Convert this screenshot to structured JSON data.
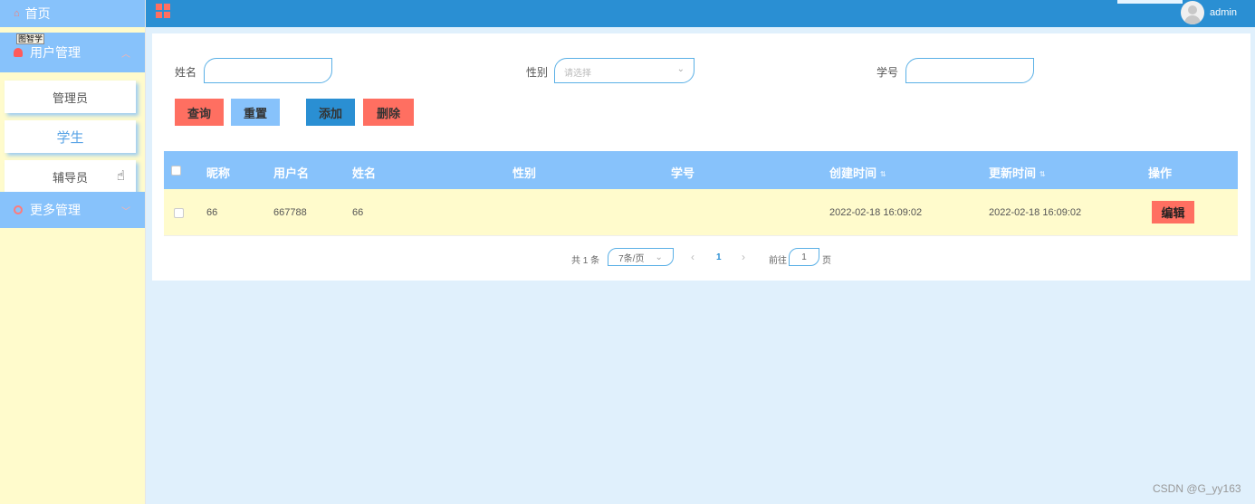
{
  "sidebar": {
    "home": "首页",
    "user_mgmt": "用户管理",
    "user_tag": "图智学",
    "items": [
      {
        "label": "管理员"
      },
      {
        "label": "学生"
      },
      {
        "label": "辅导员"
      }
    ],
    "more_mgmt": "更多管理"
  },
  "header": {
    "user": "admin"
  },
  "filters": {
    "name_label": "姓名",
    "name_value": "",
    "gender_label": "性别",
    "gender_placeholder": "请选择",
    "student_no_label": "学号",
    "student_no_value": ""
  },
  "actions": {
    "search": "查询",
    "reset": "重置",
    "add": "添加",
    "delete": "删除"
  },
  "table": {
    "columns": [
      "昵称",
      "用户名",
      "姓名",
      "性别",
      "学号",
      "创建时间",
      "更新时间",
      "操作"
    ],
    "rows": [
      {
        "nickname": "66",
        "username": "667788",
        "name": "66",
        "gender": "",
        "student_no": "",
        "created": "2022-02-18 16:09:02",
        "updated": "2022-02-18 16:09:02",
        "action": "编辑"
      }
    ]
  },
  "pagination": {
    "total": "共 1 条",
    "page_size": "7条/页",
    "prev": "‹",
    "current": "1",
    "next": "›",
    "goto_prefix": "前往",
    "goto_value": "1",
    "goto_suffix": "页"
  },
  "colors": {
    "sidebar_bg": "#fffbcc",
    "menu_blue": "#87c2fb",
    "topbar_blue": "#2a8fd3",
    "danger": "#ff6f61",
    "primary": "#2a8fd3",
    "light_blue": "#87c2fb"
  },
  "watermark": "CSDN @G_yy163"
}
